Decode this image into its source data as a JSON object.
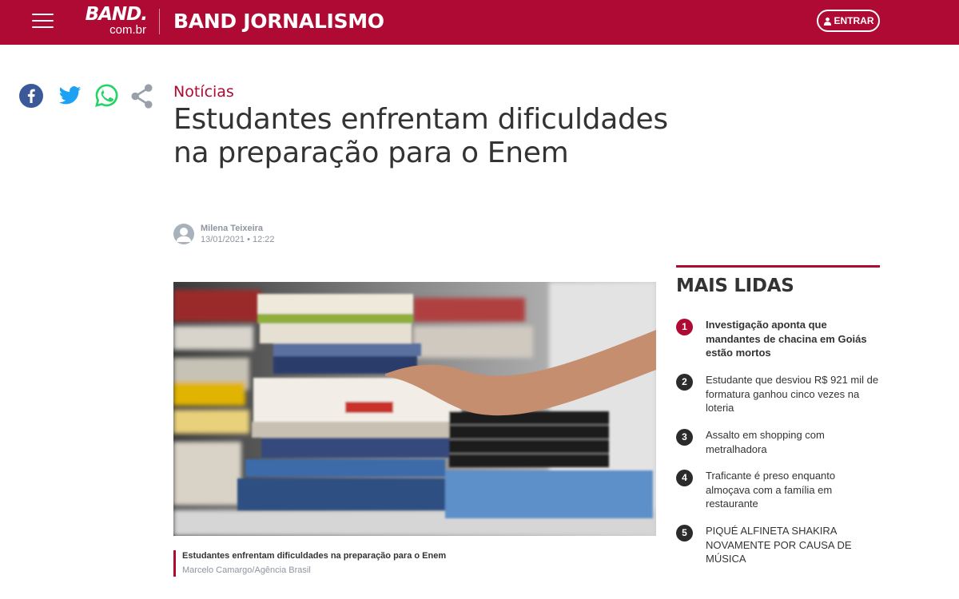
{
  "header": {
    "logo_main": "BAND.",
    "logo_sub": "com.br",
    "section_title": "BAND JORNALISMO",
    "login_label": "ENTRAR"
  },
  "share": {
    "icons": [
      "facebook-icon",
      "twitter-icon",
      "whatsapp-icon",
      "share-icon"
    ]
  },
  "article": {
    "category": "Notícias",
    "headline": "Estudantes enfrentam dificuldades na preparação para o Enem",
    "author": "Milena Teixeira",
    "datetime": "13/01/2021 • 12:22",
    "image_caption": "Estudantes enfrentam dificuldades na preparação para o Enem",
    "image_credit": "Marcelo Camargo/Agência Brasil"
  },
  "most_read": {
    "title": "MAIS LIDAS",
    "items": [
      {
        "rank": "1",
        "text": "Investigação aponta que mandantes de chacina em Goiás estão mortos"
      },
      {
        "rank": "2",
        "text": "Estudante que desviou R$ 921 mil de formatura ganhou cinco vezes na loteria"
      },
      {
        "rank": "3",
        "text": "Assalto em shopping com metralhadora"
      },
      {
        "rank": "4",
        "text": "Traficante é preso enquanto almoçava com a família em restaurante"
      },
      {
        "rank": "5",
        "text": "PIQUÉ ALFINETA SHAKIRA NOVAMENTE POR CAUSA DE MÚSICA"
      }
    ]
  },
  "colors": {
    "brand": "#ae0a33",
    "text": "#333333",
    "muted": "#8e95a0",
    "facebook": "#3b5998",
    "twitter": "#1da1f2",
    "whatsapp": "#25d366",
    "share": "#9aa0a9"
  }
}
